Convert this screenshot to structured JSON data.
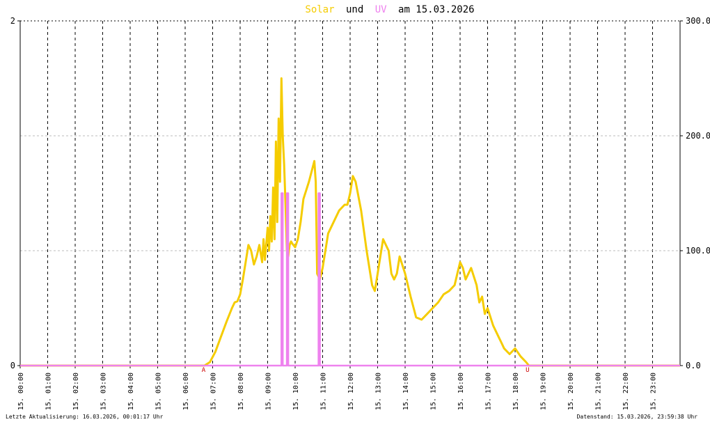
{
  "title": {
    "solar": "Solar",
    "und": "und",
    "uv": "UV",
    "am": "am 15.03.2026"
  },
  "colors": {
    "solar": "#f5cc00",
    "uv": "#ee82ee",
    "baseline": "#ff8c69",
    "marker": "#cc0000"
  },
  "footer": {
    "left": "Letzte Aktualisierung: 16.03.2026, 00:01:17 Uhr",
    "right": "Datenstand: 15.03.2026, 23:59:38 Uhr"
  },
  "chart_data": {
    "type": "line",
    "title": "Solar und UV am 15.03.2026",
    "xlim": [
      0,
      24
    ],
    "x_ticks": [
      "15. 00:00",
      "15. 01:00",
      "15. 02:00",
      "15. 03:00",
      "15. 04:00",
      "15. 05:00",
      "15. 06:00",
      "15. 07:00",
      "15. 08:00",
      "15. 09:00",
      "15. 10:00",
      "15. 11:00",
      "15. 12:00",
      "15. 13:00",
      "15. 14:00",
      "15. 15:00",
      "15. 16:00",
      "15. 17:00",
      "15. 18:00",
      "15. 19:00",
      "15. 20:00",
      "15. 21:00",
      "15. 22:00",
      "15. 23:00"
    ],
    "y_left": {
      "min": 0,
      "max": 2,
      "ticks": [
        "0",
        "2"
      ]
    },
    "y_right": {
      "min": 0,
      "max": 300,
      "ticks": [
        "0.0",
        "100.0",
        "200.0",
        "300.0"
      ]
    },
    "grid": true,
    "markers": [
      {
        "label": "A",
        "x": 6.67
      },
      {
        "label": "U",
        "x": 18.45
      }
    ],
    "series": [
      {
        "name": "Solar",
        "axis": "right",
        "x": [
          0,
          6.7,
          6.9,
          7.1,
          7.3,
          7.5,
          7.7,
          7.8,
          7.9,
          8.0,
          8.1,
          8.2,
          8.3,
          8.4,
          8.5,
          8.6,
          8.7,
          8.8,
          8.85,
          8.9,
          9.0,
          9.05,
          9.1,
          9.15,
          9.2,
          9.25,
          9.3,
          9.35,
          9.4,
          9.45,
          9.5,
          9.55,
          9.6,
          9.65,
          9.7,
          9.75,
          9.8,
          9.85,
          9.9,
          10.0,
          10.1,
          10.2,
          10.3,
          10.5,
          10.7,
          10.75,
          10.8,
          10.9,
          11.0,
          11.2,
          11.4,
          11.6,
          11.8,
          11.9,
          12.0,
          12.1,
          12.2,
          12.4,
          12.6,
          12.8,
          12.9,
          13.0,
          13.1,
          13.2,
          13.4,
          13.5,
          13.6,
          13.7,
          13.8,
          14.0,
          14.2,
          14.4,
          14.6,
          14.8,
          15.0,
          15.2,
          15.4,
          15.6,
          15.8,
          15.9,
          16.0,
          16.1,
          16.2,
          16.4,
          16.6,
          16.7,
          16.8,
          16.9,
          17.0,
          17.2,
          17.4,
          17.5,
          17.6,
          17.8,
          18.0,
          18.2,
          18.4,
          18.5,
          24
        ],
        "values": [
          0,
          0,
          3,
          12,
          25,
          38,
          50,
          55,
          56,
          62,
          75,
          90,
          105,
          100,
          88,
          95,
          105,
          90,
          110,
          92,
          120,
          100,
          130,
          108,
          155,
          110,
          195,
          125,
          215,
          160,
          250,
          200,
          175,
          140,
          100,
          95,
          105,
          108,
          106,
          103,
          110,
          125,
          145,
          160,
          178,
          160,
          80,
          75,
          85,
          115,
          125,
          135,
          140,
          140,
          150,
          165,
          160,
          135,
          100,
          70,
          65,
          80,
          95,
          110,
          100,
          80,
          75,
          80,
          95,
          80,
          60,
          42,
          40,
          45,
          50,
          55,
          62,
          65,
          70,
          80,
          90,
          85,
          75,
          85,
          70,
          55,
          60,
          45,
          50,
          35,
          25,
          20,
          15,
          10,
          15,
          8,
          3,
          0,
          0
        ]
      },
      {
        "name": "UV",
        "axis": "left",
        "x": [
          0,
          9.5,
          9.5,
          9.55,
          9.55,
          9.7,
          9.7,
          9.75,
          9.75,
          10.85,
          10.85,
          10.9,
          10.9,
          24
        ],
        "values": [
          0,
          0,
          1,
          1,
          0,
          0,
          1,
          1,
          0,
          0,
          1,
          1,
          0,
          0
        ]
      }
    ]
  }
}
